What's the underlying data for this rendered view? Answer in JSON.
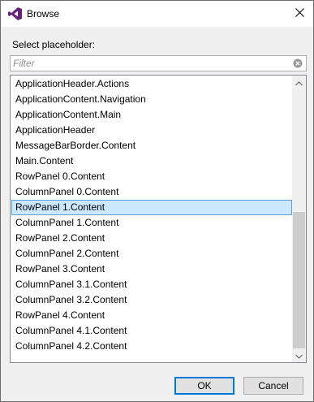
{
  "window": {
    "title": "Browse"
  },
  "dialog": {
    "label": "Select placeholder:"
  },
  "filter": {
    "placeholder": "Filter",
    "value": ""
  },
  "list": {
    "items": [
      "ApplicationHeader.Actions",
      "ApplicationContent.Navigation",
      "ApplicationContent.Main",
      "ApplicationHeader",
      "MessageBarBorder.Content",
      "Main.Content",
      "RowPanel 0.Content",
      "ColumnPanel 0.Content",
      "RowPanel 1.Content",
      "ColumnPanel 1.Content",
      "RowPanel 2.Content",
      "ColumnPanel 2.Content",
      "RowPanel 3.Content",
      "ColumnPanel 3.1.Content",
      "ColumnPanel 3.2.Content",
      "RowPanel 4.Content",
      "ColumnPanel 4.1.Content",
      "ColumnPanel 4.2.Content"
    ],
    "selected_index": 8
  },
  "buttons": {
    "ok": "OK",
    "cancel": "Cancel"
  },
  "colors": {
    "accent": "#0078d7",
    "selection": "#cce8ff",
    "logo": "#68217a"
  },
  "icons": {
    "app": "visual-studio-logo-icon",
    "close": "close-icon",
    "clear": "clear-filter-icon"
  }
}
